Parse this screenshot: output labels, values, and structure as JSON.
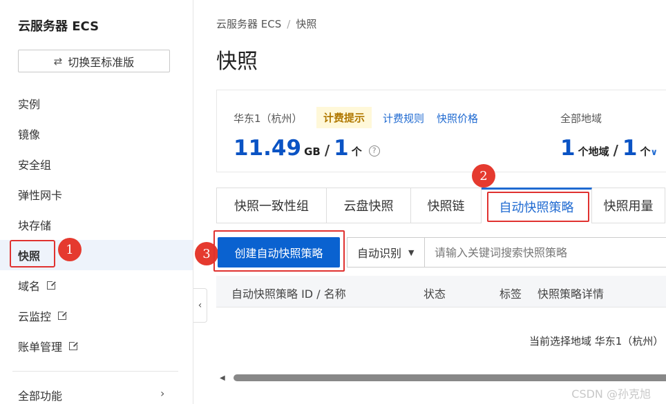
{
  "sidebar": {
    "title": "云服务器 ECS",
    "switch_button": "切换至标准版",
    "items": [
      {
        "label": "实例"
      },
      {
        "label": "镜像"
      },
      {
        "label": "安全组"
      },
      {
        "label": "弹性网卡"
      },
      {
        "label": "块存储"
      },
      {
        "label": "快照"
      },
      {
        "label": "域名"
      },
      {
        "label": "云监控"
      },
      {
        "label": "账单管理"
      }
    ],
    "all_functions": "全部功能"
  },
  "annotations": {
    "b1": "1",
    "b2": "2",
    "b3": "3"
  },
  "breadcrumb": {
    "root": "云服务器 ECS",
    "sep": "/",
    "current": "快照"
  },
  "page_title": "快照",
  "summary": {
    "region": "华东1（杭州）",
    "tip": "计费提示",
    "link_rules": "计费规则",
    "link_price": "快照价格",
    "size_value": "11.49",
    "size_unit": "GB",
    "slash": "/",
    "count_value": "1",
    "count_unit": "个",
    "all_region_label": "全部地域",
    "region_count": "1",
    "region_unit": "个地域",
    "total_count": "1",
    "total_unit": "个"
  },
  "tabs": [
    {
      "label": "快照一致性组"
    },
    {
      "label": "云盘快照"
    },
    {
      "label": "快照链"
    },
    {
      "label": "自动快照策略"
    },
    {
      "label": "快照用量"
    }
  ],
  "toolbar": {
    "create_button": "创建自动快照策略",
    "select_value": "自动识别",
    "search_placeholder": "请输入关键词搜索快照策略"
  },
  "table": {
    "columns": [
      "自动快照策略 ID / 名称",
      "状态",
      "标签",
      "快照策略详情"
    ],
    "empty_note": "当前选择地域 华东1（杭州）"
  },
  "watermark": "CSDN @孙克旭"
}
